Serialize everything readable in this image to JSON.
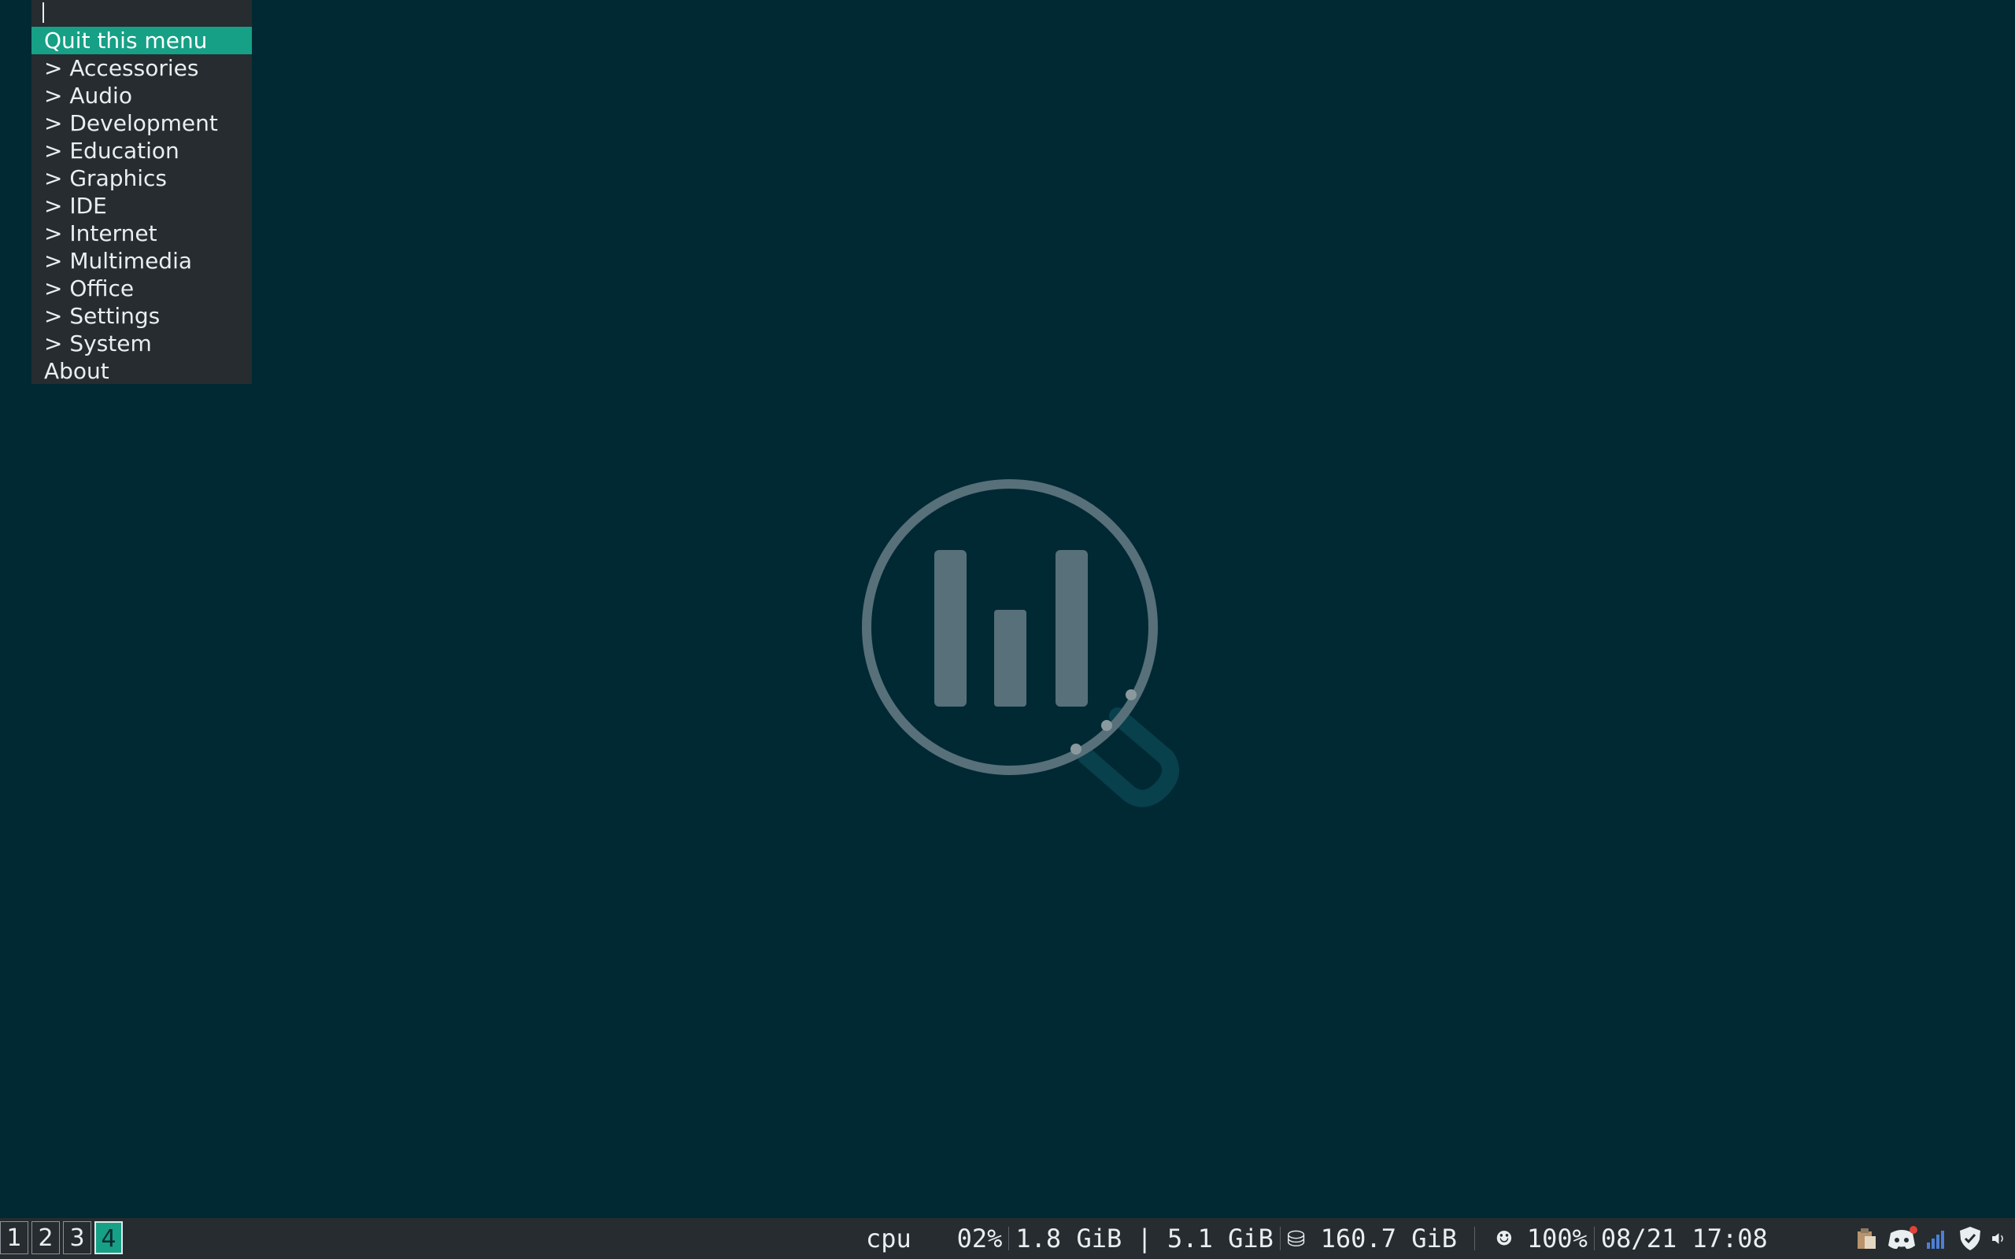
{
  "menu": {
    "search_value": "",
    "items": [
      {
        "label": "Quit this menu",
        "selected": true
      },
      {
        "label": "> Accessories"
      },
      {
        "label": "> Audio"
      },
      {
        "label": "> Development"
      },
      {
        "label": "> Education"
      },
      {
        "label": "> Graphics"
      },
      {
        "label": "> IDE"
      },
      {
        "label": "> Internet"
      },
      {
        "label": "> Multimedia"
      },
      {
        "label": "> Office"
      },
      {
        "label": "> Settings"
      },
      {
        "label": "> System"
      },
      {
        "label": "About"
      }
    ]
  },
  "bar": {
    "workspaces": [
      "1",
      "2",
      "3",
      "4"
    ],
    "active_workspace": "4",
    "cpu_label": "cpu",
    "cpu_value": "02%",
    "memory": "1.8 GiB | 5.1 GiB",
    "disk_icon": "⛁",
    "disk": "160.7 GiB",
    "battery_icon": "☻",
    "battery": "100%",
    "datetime": "08/21 17:08",
    "tray_icons": [
      "clipboard-icon",
      "discord-icon",
      "network-signal-icon",
      "shield-check-icon",
      "volume-icon"
    ]
  },
  "colors": {
    "desktop": "#012934",
    "bar": "#262c2f",
    "accent": "#16a085",
    "logo": "#58707a"
  }
}
